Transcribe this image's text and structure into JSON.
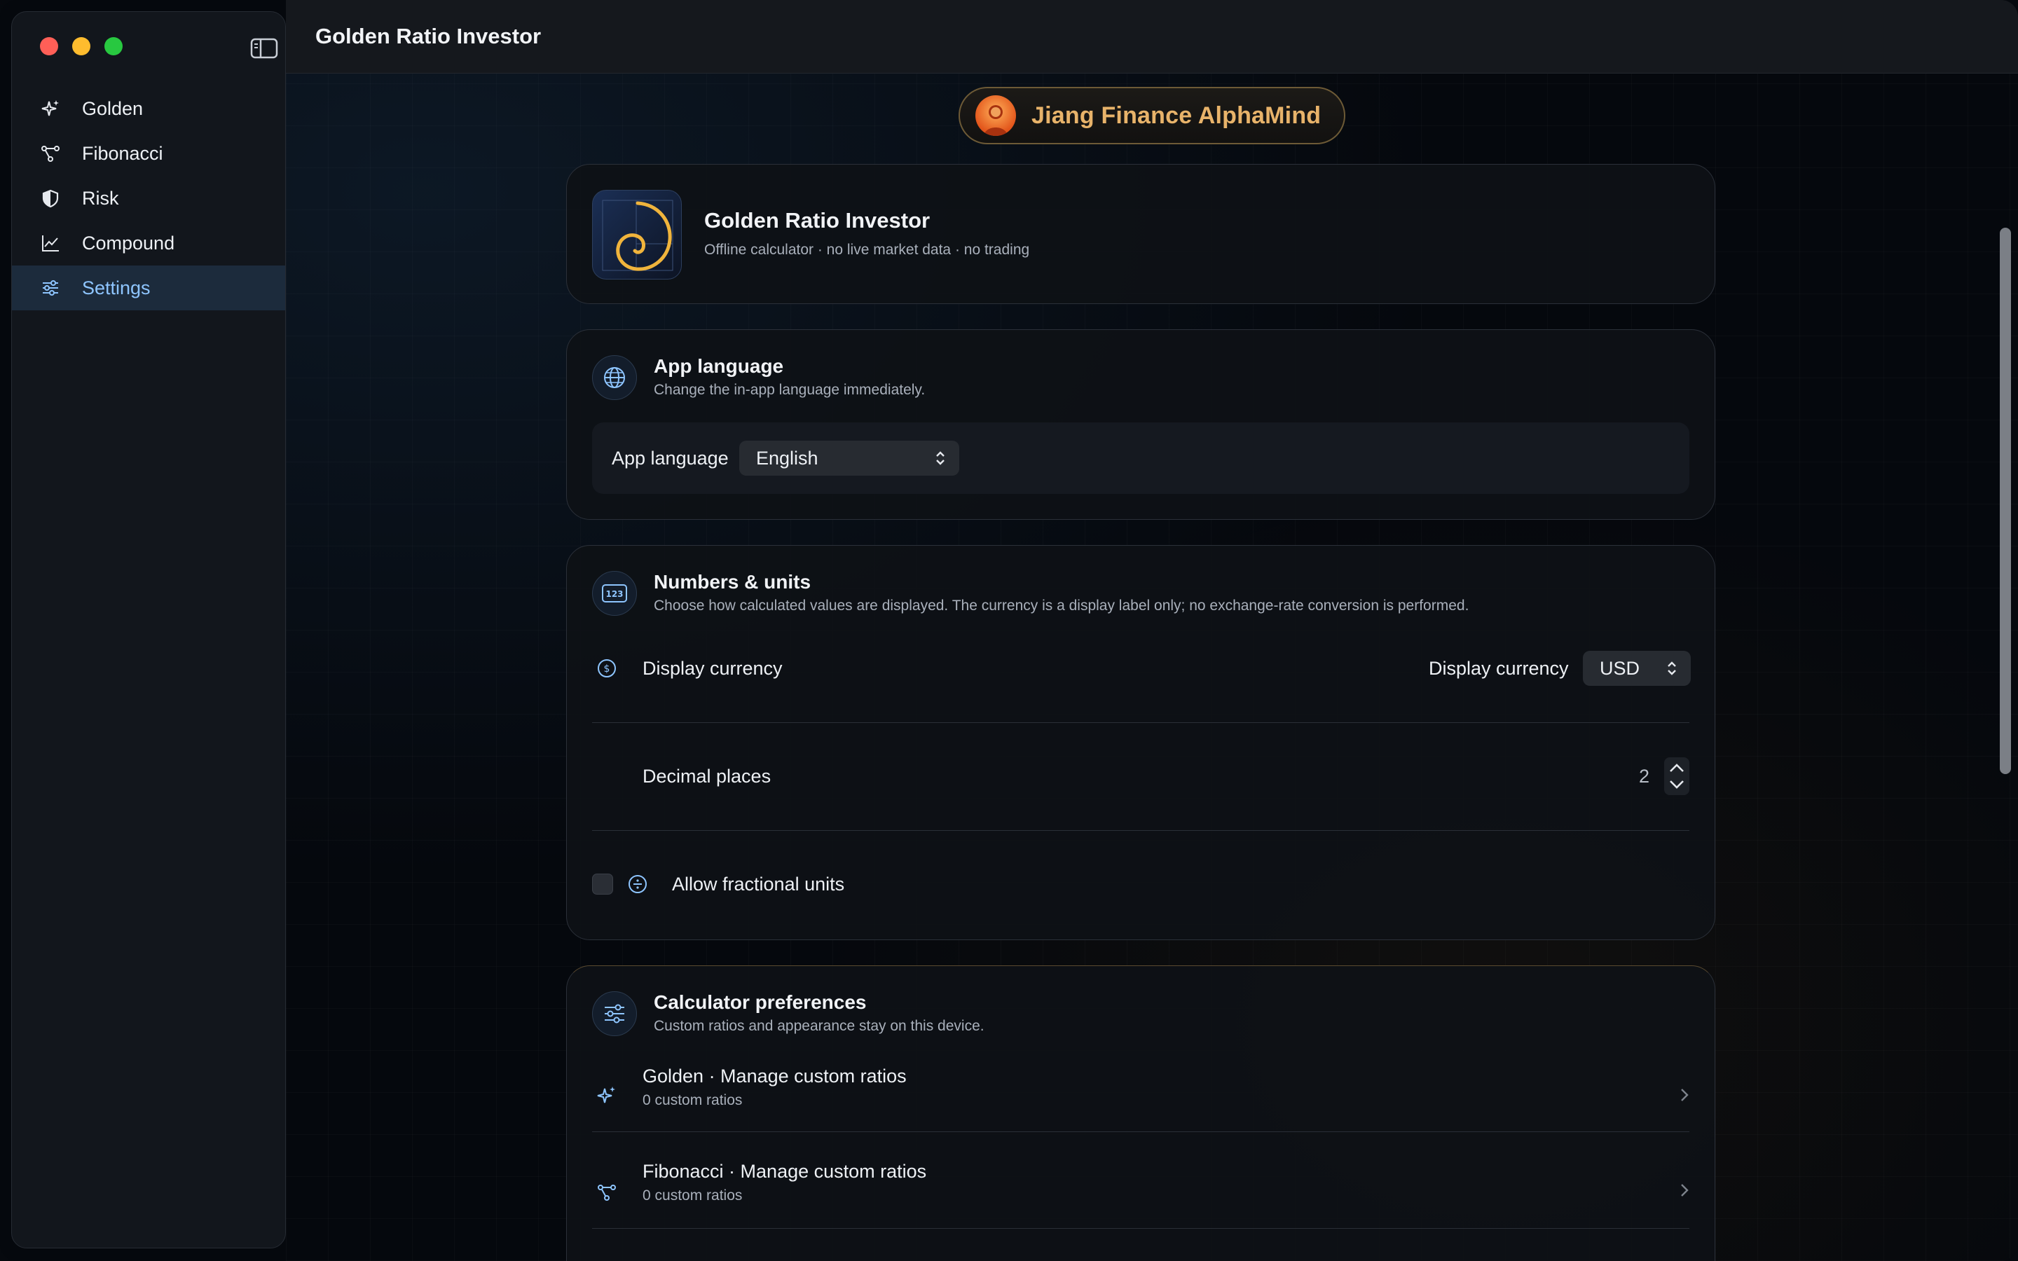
{
  "window": {
    "title": "Golden Ratio Investor"
  },
  "sidebar": {
    "items": [
      {
        "label": "Golden",
        "icon": "sparkles-icon"
      },
      {
        "label": "Fibonacci",
        "icon": "nodes-icon"
      },
      {
        "label": "Risk",
        "icon": "shield-icon"
      },
      {
        "label": "Compound",
        "icon": "chart-line-icon"
      },
      {
        "label": "Settings",
        "icon": "sliders-icon",
        "active": true
      }
    ]
  },
  "brand": {
    "name": "Jiang Finance AlphaMind"
  },
  "about": {
    "title": "Golden Ratio Investor",
    "subtitle": "Offline calculator · no live market data · no trading"
  },
  "language": {
    "title": "App language",
    "subtitle": "Change the in-app language immediately.",
    "field_label": "App language",
    "selected": "English"
  },
  "numbers": {
    "title": "Numbers & units",
    "subtitle": "Choose how calculated values are displayed. The currency is a display label only; no exchange-rate conversion is performed.",
    "currency_row_label": "Display currency",
    "currency_field_label": "Display currency",
    "currency_selected": "USD",
    "decimal_label": "Decimal places",
    "decimal_value": "2",
    "fractional_label": "Allow fractional units",
    "fractional_checked": false
  },
  "calculator": {
    "title": "Calculator preferences",
    "subtitle": "Custom ratios and appearance stay on this device.",
    "rows": [
      {
        "label": "Golden · Manage custom ratios",
        "sub": "0 custom ratios"
      },
      {
        "label": "Fibonacci · Manage custom ratios",
        "sub": "0 custom ratios"
      }
    ]
  },
  "colors": {
    "accent": "#8ec5ff",
    "gold": "#e8b36a",
    "background": "#05080d"
  }
}
